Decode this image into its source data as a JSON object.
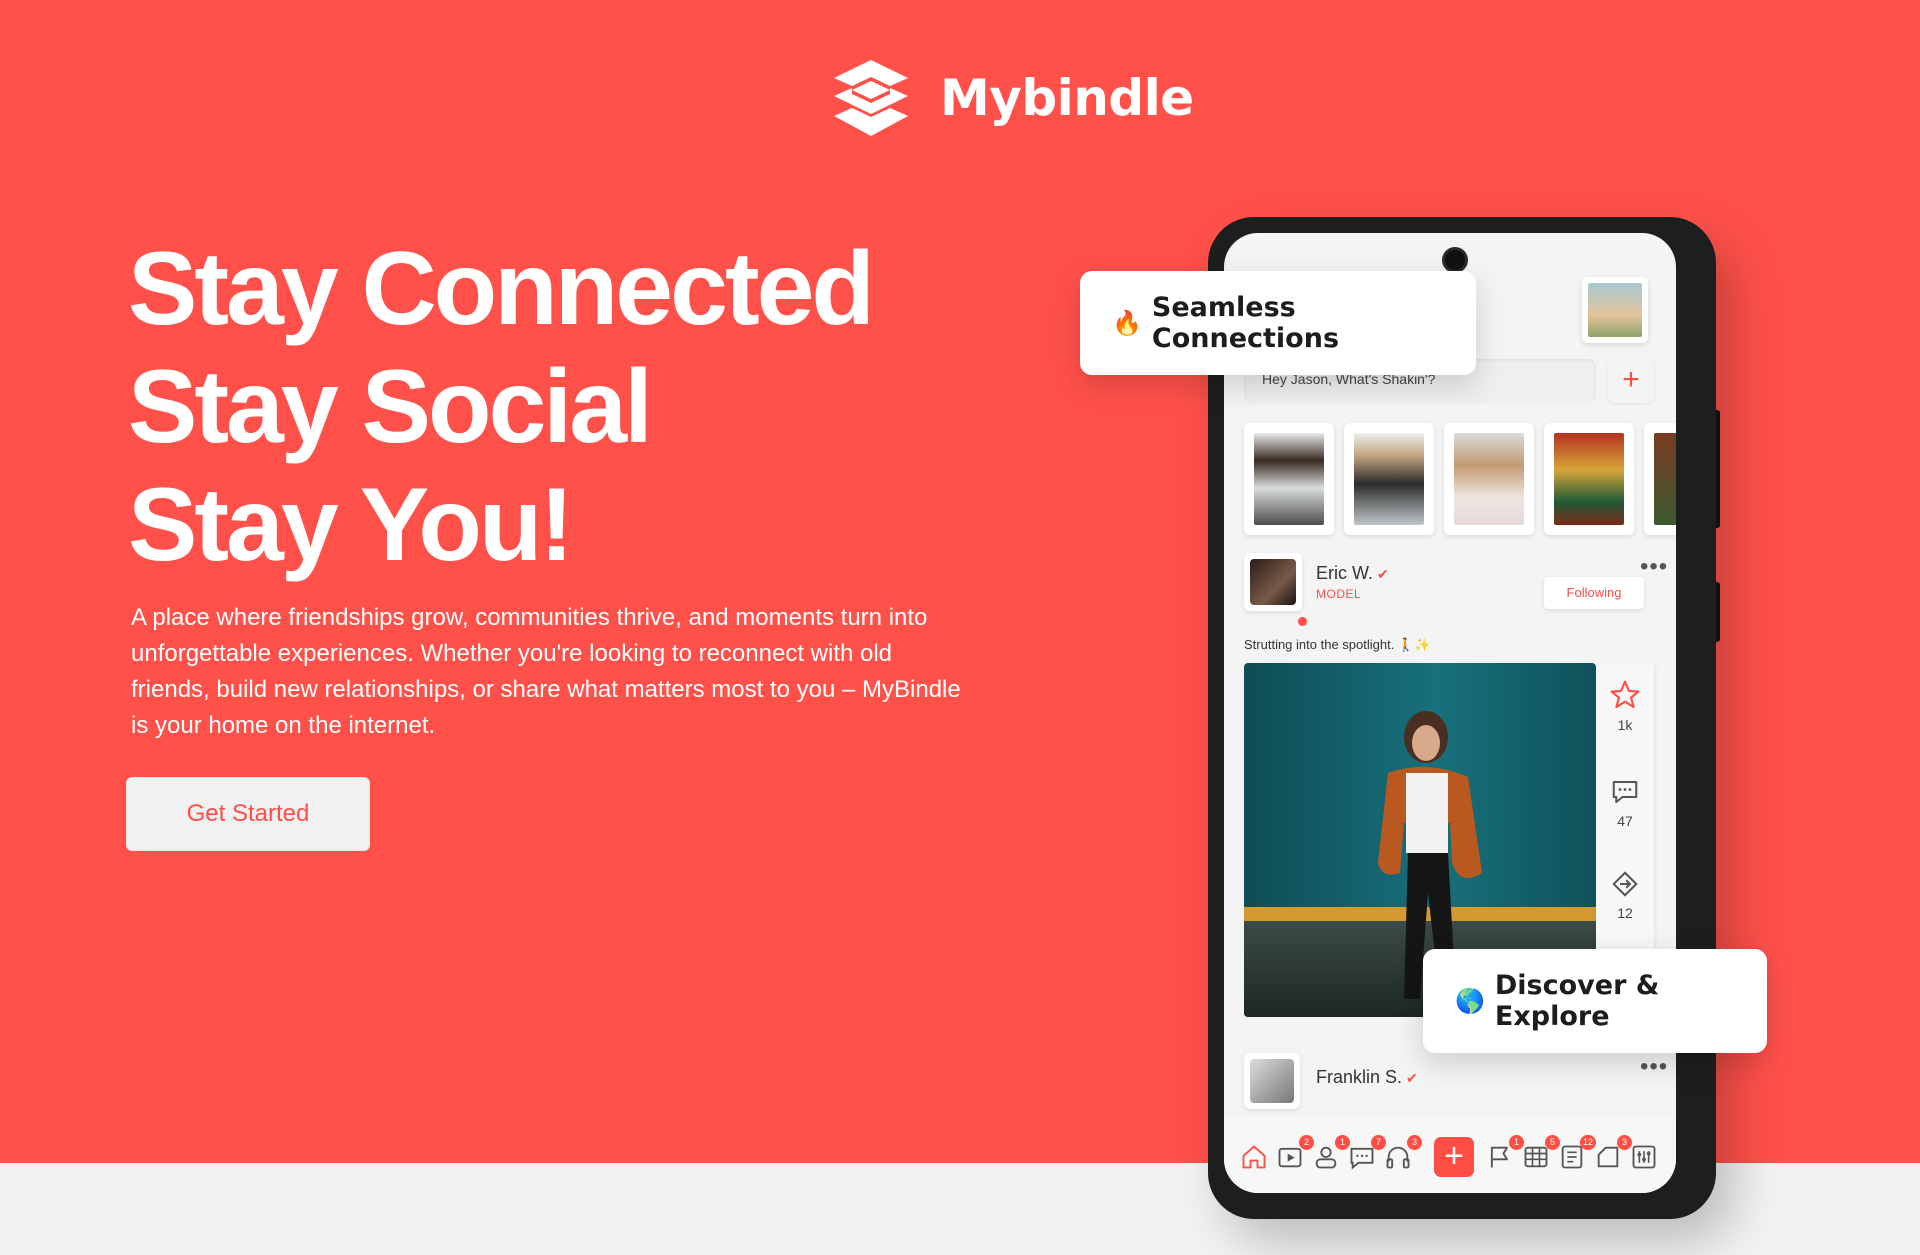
{
  "brand": {
    "name": "Mybindle",
    "color": "#ff514a"
  },
  "hero": {
    "headline": [
      "Stay Connected",
      "Stay Social",
      "Stay You!"
    ],
    "lead": "A place where friendships grow, communities thrive, and moments turn into unforgettable experiences. Whether you're looking to reconnect with old friends, build new relationships, or share what matters most to you – MyBindle is your home on the internet.",
    "cta_label": "Get Started"
  },
  "cards": {
    "seamless": {
      "emoji": "🔥",
      "label": "Seamless Connections"
    },
    "discover": {
      "emoji": "🌎",
      "label": "Discover & Explore"
    }
  },
  "app": {
    "status_placeholder": "Hey Jason, What's Shakin'?",
    "add_symbol": "+",
    "post": {
      "name": "Eric W.",
      "verified": "✔",
      "role": "MODEL",
      "follow_label": "Following",
      "more": "•••",
      "caption": "Strutting into the spotlight. 🚶✨",
      "likes": "1k",
      "comments": "47",
      "shares": "12"
    },
    "post2": {
      "name": "Franklin S.",
      "verified": "✔",
      "more": "•••"
    },
    "nav": {
      "badges": [
        "2",
        "1",
        "7",
        "3",
        "1",
        "5",
        "12",
        "3"
      ],
      "plus": "+"
    }
  }
}
